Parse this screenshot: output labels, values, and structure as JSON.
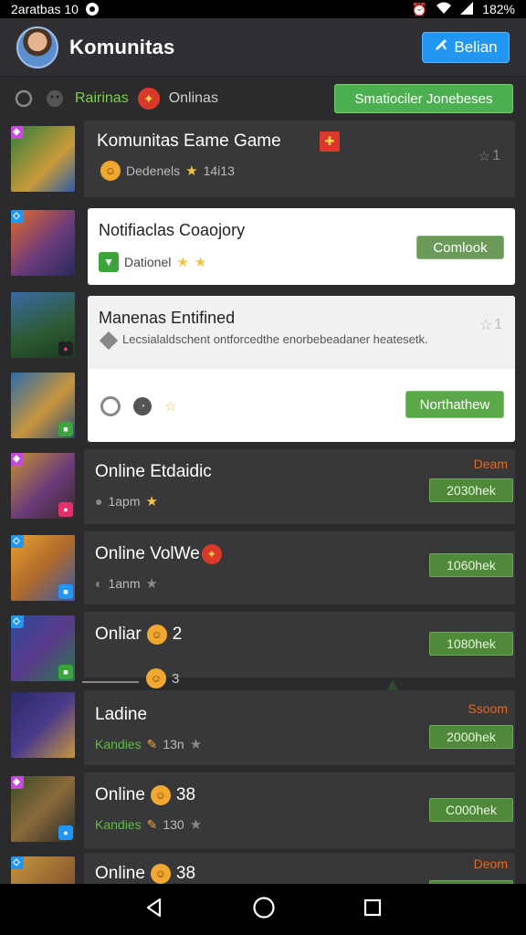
{
  "status": {
    "time": "2aratbas 10",
    "battery": "182%"
  },
  "header": {
    "title": "Komunitas",
    "action_label": "Belian",
    "action_icon": "edit-icon"
  },
  "filters": {
    "tab_1": "Rairinas",
    "tab_2": "Onlinas",
    "button": "Smatiociler Jonebeses"
  },
  "rows": [
    {
      "title": "Komunitas Eame Game",
      "meta": "Dedenels",
      "rating": "14i13",
      "count": "1"
    },
    {
      "title": "Notifiaclas Coaojory",
      "meta": "Dationel",
      "button": "Comlook"
    },
    {
      "title": "Manenas Entifined",
      "desc": "Lecsialaldschent ontforcedthe enorbebeadaner heatesetk.",
      "count": "1",
      "button": "Northathew"
    },
    {
      "title": "Online Etdaidic",
      "meta": "1apm",
      "label": "Deam",
      "button": "2030hek"
    },
    {
      "title": "Online VolWe",
      "meta": "1anm",
      "button": "1060hek"
    },
    {
      "title": "Onliar",
      "title_num": "2",
      "sub_num": "3",
      "button": "1080hek"
    },
    {
      "title": "Ladine",
      "meta": "Kandies",
      "meta_num": "13n",
      "label": "Ssoom",
      "button": "2000hek"
    },
    {
      "title": "Online",
      "title_num": "38",
      "meta": "Kandies",
      "meta_num": "130",
      "button": "C000hek"
    },
    {
      "title": "Online",
      "title_num": "38",
      "label": "Deom"
    }
  ]
}
